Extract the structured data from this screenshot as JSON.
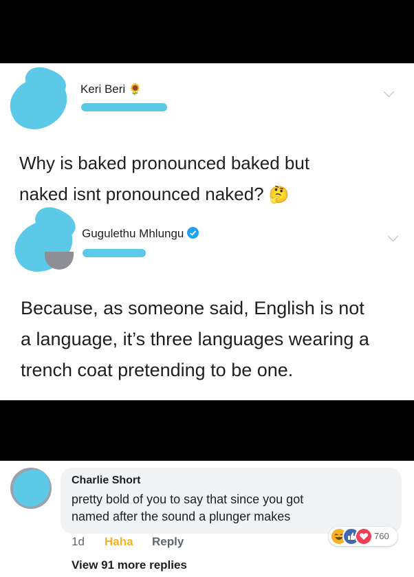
{
  "tweet": {
    "author_name": "Keri Beri",
    "author_emoji": "🌻",
    "text_line1": "Why is baked pronounced baked but",
    "text_line2": "naked isnt pronounced naked?",
    "text_emoji": "🤔"
  },
  "reply": {
    "author_name": "Gugulethu Mhlungu",
    "verified_icon": "verified-badge",
    "text_line1": "Because, as someone said, English is not",
    "text_line2": "a language, it’s three languages wearing a",
    "text_line3": "trench coat pretending to be one."
  },
  "comment": {
    "author_name": "Charlie Short",
    "text_line1": "pretty bold of you to say that since you got",
    "text_line2": "named after the sound a plunger makes",
    "age": "1d",
    "haha_label": "Haha",
    "reply_label": "Reply",
    "reaction_count": "760",
    "view_more": "View 91 more replies"
  },
  "colors": {
    "twitter_blue": "#1da1f2",
    "fb_blue": "#4267b2",
    "haha_yellow": "#f7b125",
    "love_red": "#f33e58"
  }
}
